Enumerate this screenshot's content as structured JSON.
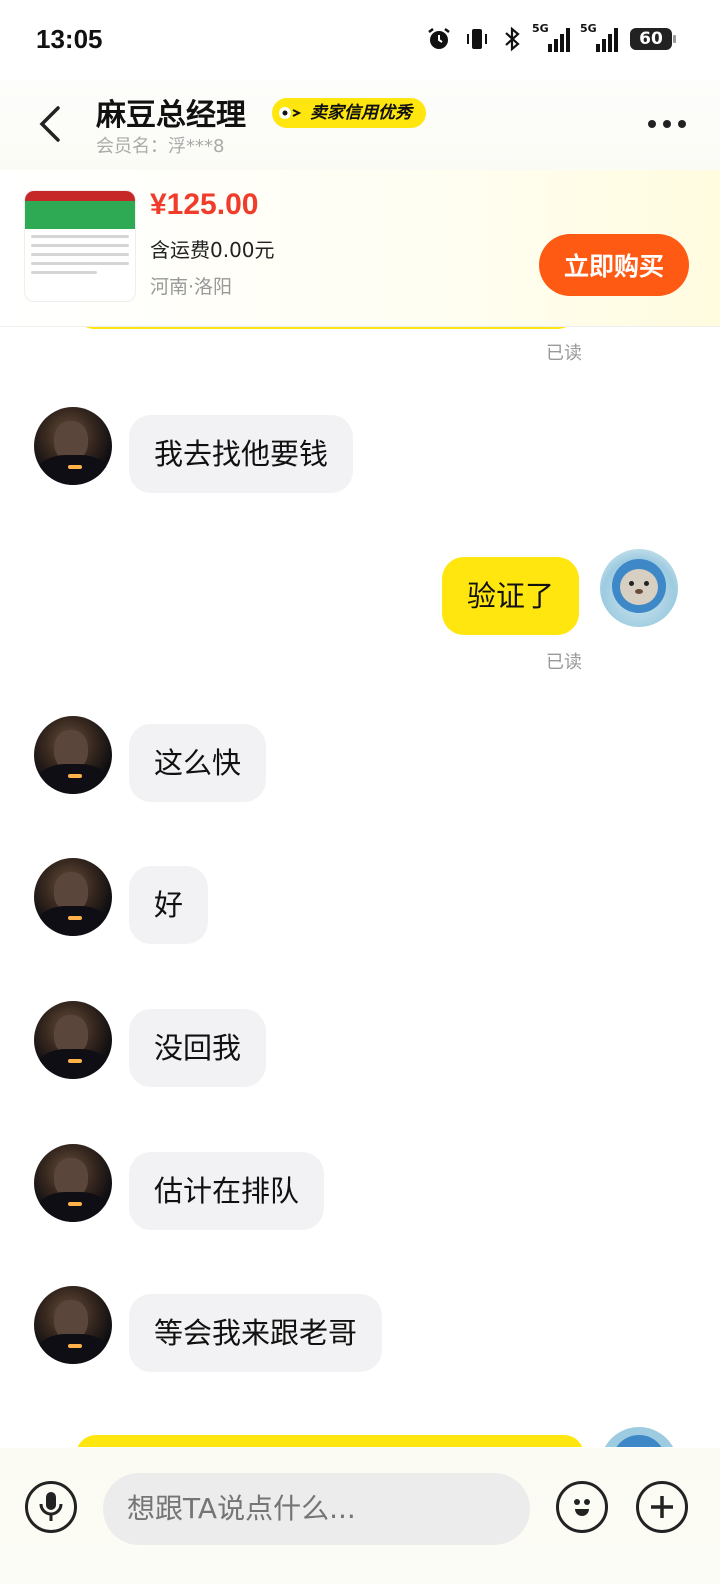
{
  "status_bar": {
    "time": "13:05",
    "network_tag_1": "5G",
    "network_tag_2": "5G",
    "battery": "60"
  },
  "header": {
    "title": "麻豆总经理",
    "badge": "卖家信用优秀",
    "member_name": "会员名：浮***8"
  },
  "product": {
    "price": "¥125.00",
    "shipping": "含运费0.00元",
    "location": "河南·洛阳",
    "buy_label": "立即购买"
  },
  "messages": [
    {
      "side": "read",
      "text": "已读"
    },
    {
      "side": "left",
      "text": "我去找他要钱"
    },
    {
      "side": "right",
      "text": "验证了",
      "read": "已读"
    },
    {
      "side": "left",
      "text": "这么快"
    },
    {
      "side": "left",
      "text": "好"
    },
    {
      "side": "left",
      "text": "没回我"
    },
    {
      "side": "left",
      "text": "估计在排队"
    },
    {
      "side": "left",
      "text": "等会我来跟老哥"
    }
  ],
  "input": {
    "placeholder": "想跟TA说点什么..."
  },
  "colors": {
    "accent_yellow": "#ffe60f",
    "buy_orange": "#ff5a14",
    "price_red": "#f03c2a"
  },
  "icons": [
    "alarm-icon",
    "vibrate-icon",
    "bluetooth-icon",
    "back-icon",
    "more-icon",
    "microphone-icon",
    "emoji-icon",
    "plus-icon"
  ]
}
